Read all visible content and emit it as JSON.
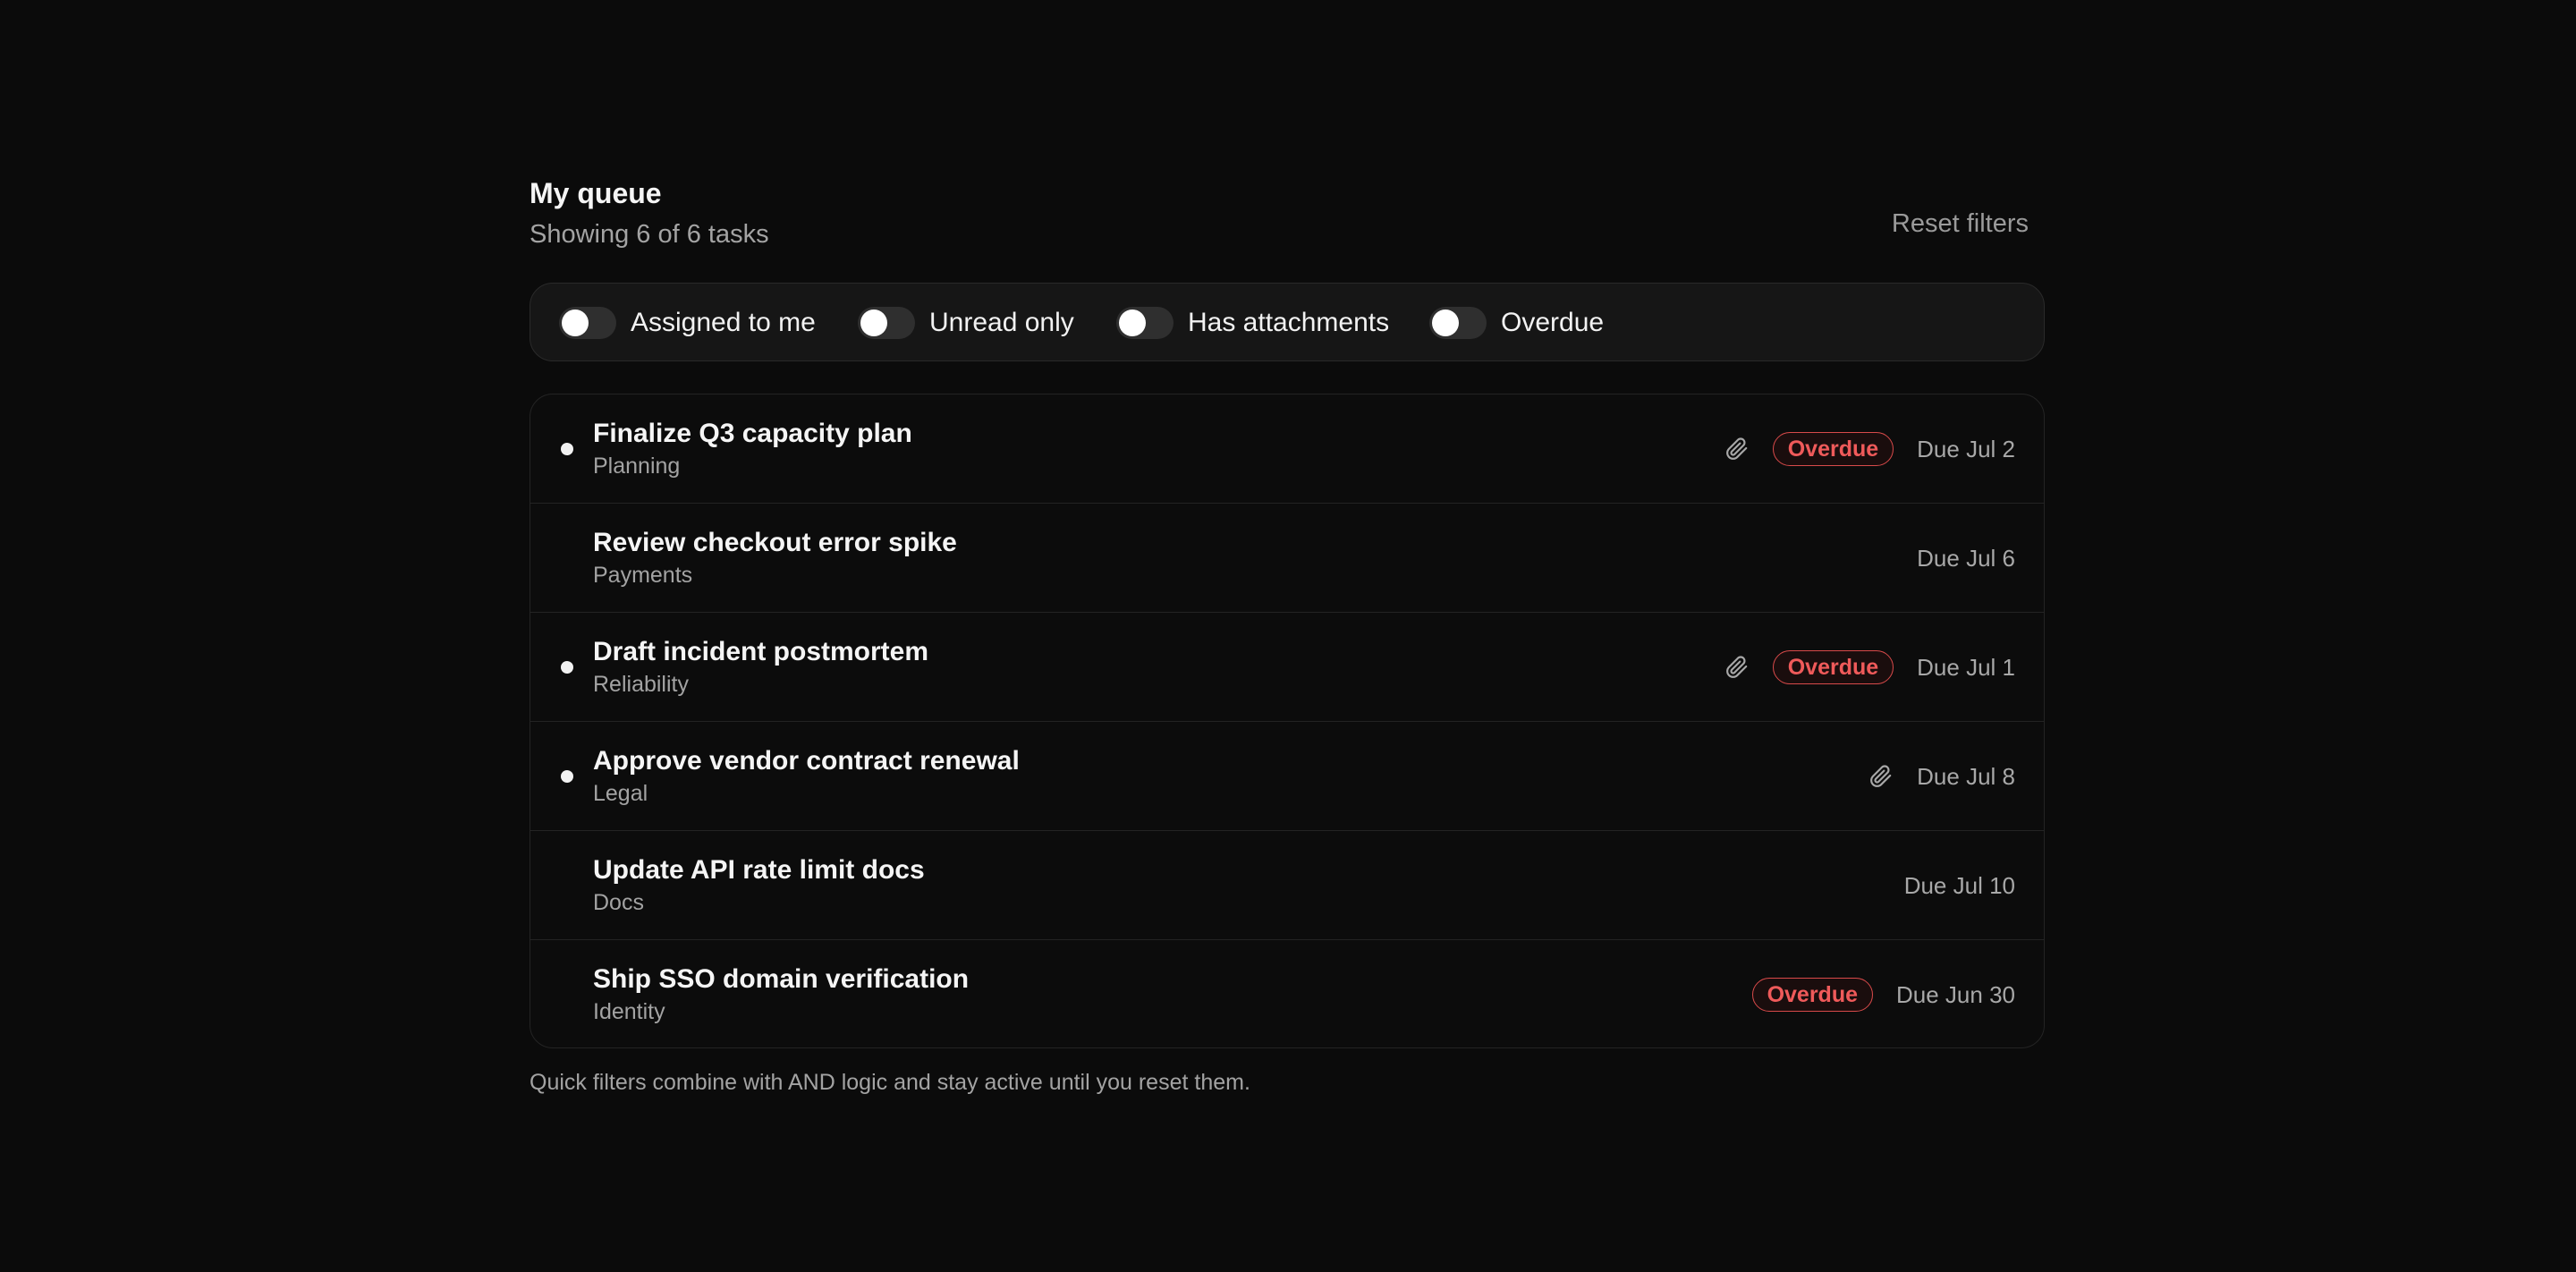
{
  "header": {
    "title": "My queue",
    "subtitle": "Showing 6 of 6 tasks",
    "reset_label": "Reset filters"
  },
  "filters": [
    {
      "label": "Assigned to me",
      "on": false
    },
    {
      "label": "Unread only",
      "on": false
    },
    {
      "label": "Has attachments",
      "on": false
    },
    {
      "label": "Overdue",
      "on": false
    }
  ],
  "tasks": [
    {
      "title": "Finalize Q3 capacity plan",
      "category": "Planning",
      "unread": true,
      "attachment": true,
      "badge": "Overdue",
      "due": "Due Jul 2"
    },
    {
      "title": "Review checkout error spike",
      "category": "Payments",
      "unread": false,
      "attachment": false,
      "badge": "",
      "due": "Due Jul 6"
    },
    {
      "title": "Draft incident postmortem",
      "category": "Reliability",
      "unread": true,
      "attachment": true,
      "badge": "Overdue",
      "due": "Due Jul 1"
    },
    {
      "title": "Approve vendor contract renewal",
      "category": "Legal",
      "unread": true,
      "attachment": true,
      "badge": "",
      "due": "Due Jul 8"
    },
    {
      "title": "Update API rate limit docs",
      "category": "Docs",
      "unread": false,
      "attachment": false,
      "badge": "",
      "due": "Due Jul 10"
    },
    {
      "title": "Ship SSO domain verification",
      "category": "Identity",
      "unread": false,
      "attachment": false,
      "badge": "Overdue",
      "due": "Due Jun 30"
    }
  ],
  "footnote": "Quick filters combine with AND logic and stay active until you reset them.",
  "colors": {
    "background": "#0b0b0b",
    "overdue": "#ef5a5a",
    "muted_text": "#a3a3a3"
  },
  "icons": {
    "unread": "unread-dot-icon",
    "attachment": "paperclip-icon"
  }
}
